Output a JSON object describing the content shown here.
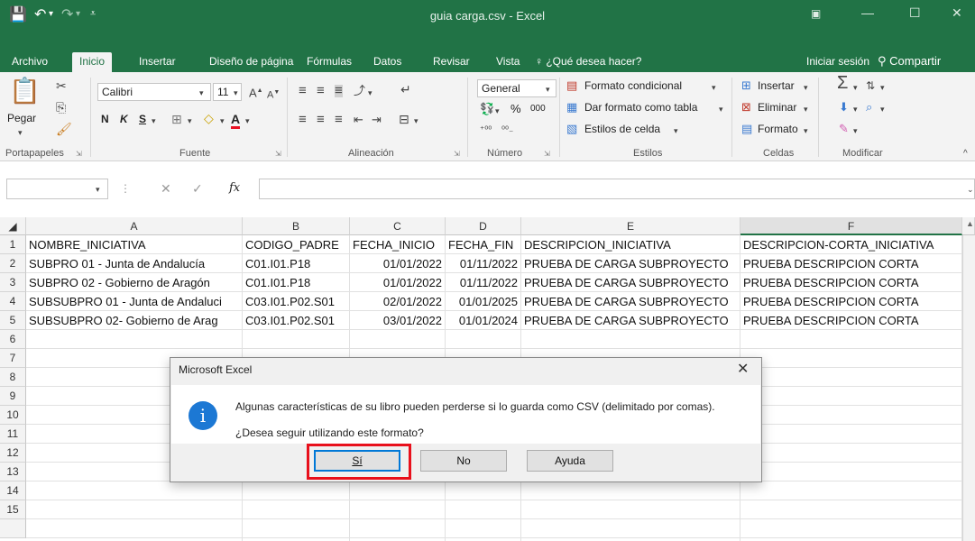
{
  "window": {
    "title": "guia carga.csv - Excel",
    "accent_color": "#217346"
  },
  "tabs": [
    "Archivo",
    "Inicio",
    "Insertar",
    "Diseño de página",
    "Fórmulas",
    "Datos",
    "Revisar",
    "Vista"
  ],
  "active_tab": "Inicio",
  "tell_me": "¿Qué desea hacer?",
  "sign_in": "Iniciar sesión",
  "share": "Compartir",
  "ribbon": {
    "paste_label": "Pegar",
    "font_name": "Calibri",
    "font_size": "11",
    "bold": "N",
    "italic": "K",
    "underline": "S",
    "number_format": "General",
    "percent": "%",
    "thousands": "000",
    "cond_format": "Formato condicional",
    "format_table": "Dar formato como tabla",
    "cell_styles": "Estilos de celda",
    "insert": "Insertar",
    "delete": "Eliminar",
    "format": "Formato",
    "groups": {
      "clipboard": "Portapapeles",
      "font": "Fuente",
      "alignment": "Alineación",
      "number": "Número",
      "styles": "Estilos",
      "cells": "Celdas",
      "editing": "Modificar"
    }
  },
  "formula_bar": {
    "name_box": "",
    "fx": "fx",
    "content": ""
  },
  "sheet": {
    "columns": [
      "A",
      "B",
      "C",
      "D",
      "E",
      "F"
    ],
    "row_numbers": [
      "1",
      "2",
      "3",
      "4",
      "5",
      "6",
      "7",
      "8",
      "9",
      "10",
      "11",
      "12",
      "13",
      "14",
      "15"
    ],
    "rows": [
      [
        "NOMBRE_INICIATIVA",
        "CODIGO_PADRE",
        "FECHA_INICIO",
        "FECHA_FIN",
        "DESCRIPCION_INICIATIVA",
        "DESCRIPCION-CORTA_INICIATIVA"
      ],
      [
        "SUBPRO 01 - Junta de Andalucía",
        "C01.I01.P18",
        "01/01/2022",
        "01/11/2022",
        "PRUEBA DE CARGA SUBPROYECTO",
        "PRUEBA DESCRIPCION CORTA"
      ],
      [
        "SUBPRO 02 - Gobierno de Aragón",
        "C01.I01.P18",
        "01/01/2022",
        "01/11/2022",
        "PRUEBA DE CARGA SUBPROYECTO",
        "PRUEBA DESCRIPCION CORTA"
      ],
      [
        "SUBSUBPRO 01 - Junta de Andaluci",
        "C03.I01.P02.S01",
        "02/01/2022",
        "01/01/2025",
        "PRUEBA DE CARGA SUBPROYECTO",
        "PRUEBA DESCRIPCION CORTA"
      ],
      [
        "SUBSUBPRO 02- Gobierno de Arag",
        "C03.I01.P02.S01",
        "03/01/2022",
        "01/01/2024",
        "PRUEBA DE CARGA SUBPROYECTO",
        "PRUEBA DESCRIPCION CORTA"
      ]
    ]
  },
  "dialog": {
    "title": "Microsoft Excel",
    "close": "✕",
    "message1": "Algunas características de su libro pueden perderse si lo guarda como CSV (delimitado por comas).",
    "message2": "¿Desea seguir utilizando este formato?",
    "buttons": [
      "Sí",
      "No",
      "Ayuda"
    ],
    "icon": "info-icon",
    "highlight_color": "#e8101c"
  }
}
